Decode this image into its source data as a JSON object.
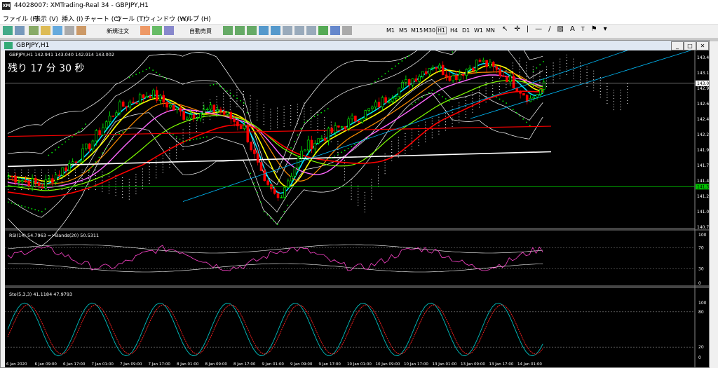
{
  "window": {
    "title": "44028007: XMTrading-Real 34 - GBPJPY,H1",
    "logo": "XM"
  },
  "menu": [
    "ファイル (F)",
    "表示 (V)",
    "挿入 (I)",
    "チャート (C)",
    "ツール (T)",
    "ウィンドウ (W)",
    "ヘルプ (H)"
  ],
  "toolbar": {
    "new_order": "新規注文",
    "auto_trading": "自動売買",
    "timeframes": [
      "M1",
      "M5",
      "M15",
      "M30",
      "H1",
      "H4",
      "D1",
      "W1",
      "MN"
    ],
    "active_timeframe": "H1"
  },
  "chart_window": {
    "title": "GBPJPY,H1"
  },
  "main_panel": {
    "header": "GBPJPY,H1  142.941 143.040 142.914 143.002",
    "countdown": "残り 17 分 30 秒",
    "price_labels": [
      "143.410",
      "143.170",
      "142.930",
      "142.685",
      "142.445",
      "142.205",
      "141.965",
      "141.720",
      "141.480",
      "141.240",
      "141.000",
      "140.755"
    ],
    "current_price": "143.002",
    "hline_price": "141.383",
    "colors": {
      "bg": "#000000",
      "bull": "#00ff00",
      "bear": "#ff0000",
      "grid": "#c0c0c0"
    }
  },
  "rsi_panel": {
    "label": "RSI(14) 54.7963  =>Bands(20) 50.5311",
    "levels": [
      "100",
      "70",
      "30",
      "0"
    ]
  },
  "sto_panel": {
    "label": "Sto(5,3,3) 41.1184 47.9793",
    "levels": [
      "100",
      "80",
      "20",
      "0"
    ]
  },
  "x_axis": [
    "6 Jan 2020",
    "6 Jan 09:00",
    "6 Jan 17:00",
    "7 Jan 01:00",
    "7 Jan 09:00",
    "7 Jan 17:00",
    "8 Jan 01:00",
    "8 Jan 09:00",
    "8 Jan 17:00",
    "9 Jan 01:00",
    "9 Jan 09:00",
    "9 Jan 17:00",
    "10 Jan 01:00",
    "10 Jan 09:00",
    "10 Jan 17:00",
    "13 Jan 01:00",
    "13 Jan 09:00",
    "13 Jan 17:00",
    "14 Jan 01:00"
  ]
}
